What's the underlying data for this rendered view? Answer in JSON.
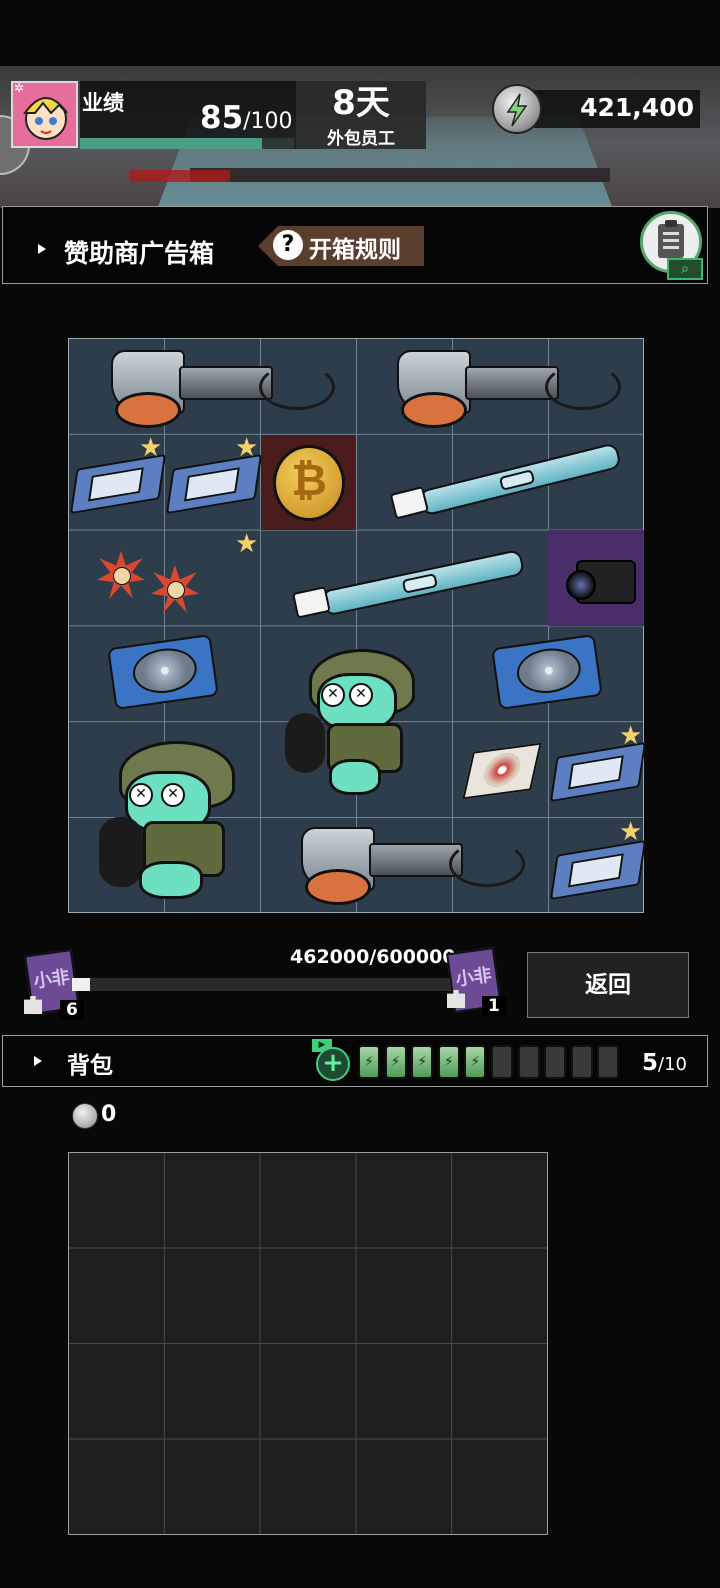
{
  "hud": {
    "performance_label": "业绩",
    "performance_current": "85",
    "performance_max": "/100",
    "performance_fraction": 0.85,
    "days": "8天",
    "role": "外包员工",
    "coins": "421,400"
  },
  "header": {
    "title": "赞助商广告箱",
    "rules_icon": "?",
    "rules_label": "开箱规则"
  },
  "box_grid": {
    "columns": 6,
    "rows": 6,
    "items": [
      {
        "name": "hair-dryer",
        "starred": false
      },
      {
        "name": "hair-dryer",
        "starred": false
      },
      {
        "name": "tablet-device",
        "starred": true
      },
      {
        "name": "tablet-device",
        "starred": true
      },
      {
        "name": "bitcoin",
        "starred": false,
        "highlight": "red",
        "glyph": "₿"
      },
      {
        "name": "electric-toothbrush",
        "starred": false
      },
      {
        "name": "star-sunglasses",
        "starred": true
      },
      {
        "name": "electric-toothbrush",
        "starred": false
      },
      {
        "name": "camera-lens",
        "starred": false,
        "highlight": "purple"
      },
      {
        "name": "cd-player",
        "starred": false
      },
      {
        "name": "frog-pilot",
        "starred": false
      },
      {
        "name": "cd-player",
        "starred": false
      },
      {
        "name": "frog-pilot",
        "starred": false
      },
      {
        "name": "cd-case",
        "starred": false
      },
      {
        "name": "tablet-device",
        "starred": true
      },
      {
        "name": "hair-dryer",
        "starred": false
      },
      {
        "name": "tablet-device",
        "starred": true
      }
    ]
  },
  "progress": {
    "text": "462000/600000",
    "current": 462000,
    "max": 600000,
    "left_ticket_glyph": "小非",
    "left_count": "6",
    "right_ticket_glyph": "小非",
    "right_count": "1"
  },
  "back_button": "返回",
  "backpack": {
    "label": "背包",
    "plus": "+",
    "video_tag": "▶",
    "batteries_filled": 5,
    "batteries_total": 10,
    "count": "5",
    "total": "/10",
    "coins": "0",
    "grid_columns": 5,
    "grid_rows": 4
  },
  "colors": {
    "accent_green": "#4b9e86",
    "rules_brown": "#5b3f2e",
    "grid_blue": "#2d3d4b",
    "star_gold": "#f4d06b"
  }
}
